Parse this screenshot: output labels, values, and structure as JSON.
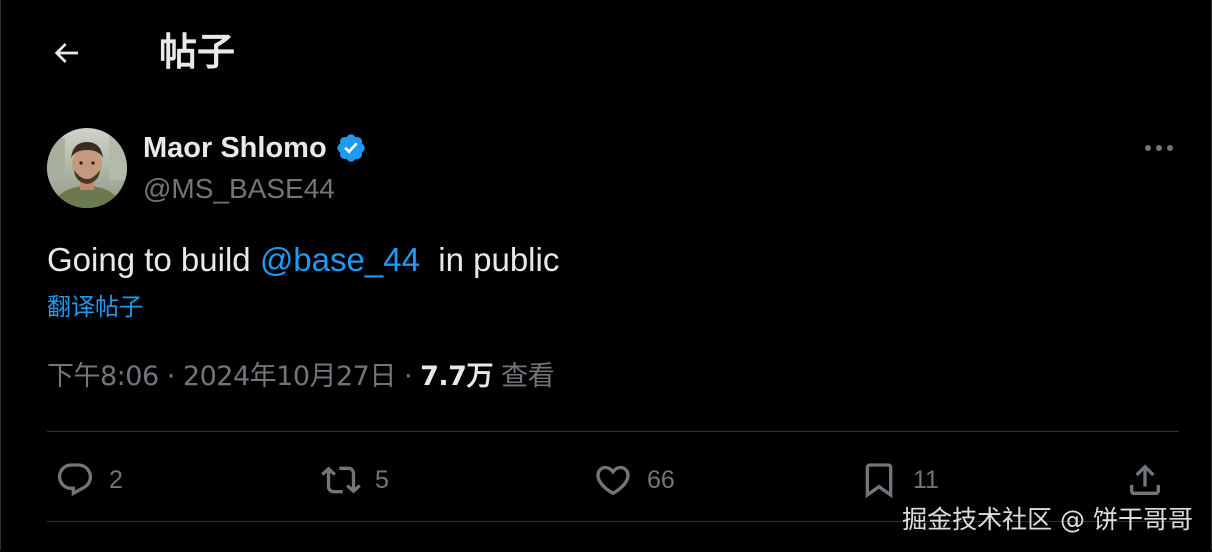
{
  "header": {
    "title": "帖子"
  },
  "author": {
    "name": "Maor Shlomo",
    "handle": "@MS_BASE44",
    "verified": true
  },
  "tweet": {
    "text_before": "Going to build ",
    "mention": "@base_44",
    "text_after": "  in public",
    "translate_label": "翻译帖子"
  },
  "meta": {
    "time": "下午8:06",
    "date": "2024年10月27日",
    "separator": "·",
    "views_count": "7.7万",
    "views_label": "查看"
  },
  "actions": {
    "replies": "2",
    "reposts": "5",
    "likes": "66",
    "bookmarks": "11"
  },
  "watermark": "掘金技术社区 @ 饼干哥哥",
  "colors": {
    "background": "#000000",
    "text_primary": "#e7e9ea",
    "text_secondary": "#71767b",
    "accent": "#1d9bf0",
    "divider": "#2f3336"
  },
  "icons": {
    "back": "arrow-left-icon",
    "verified": "verified-badge-icon",
    "more": "more-dots-icon",
    "reply": "reply-bubble-icon",
    "repost": "repost-icon",
    "like": "heart-icon",
    "bookmark": "bookmark-icon",
    "share": "share-upload-icon"
  }
}
